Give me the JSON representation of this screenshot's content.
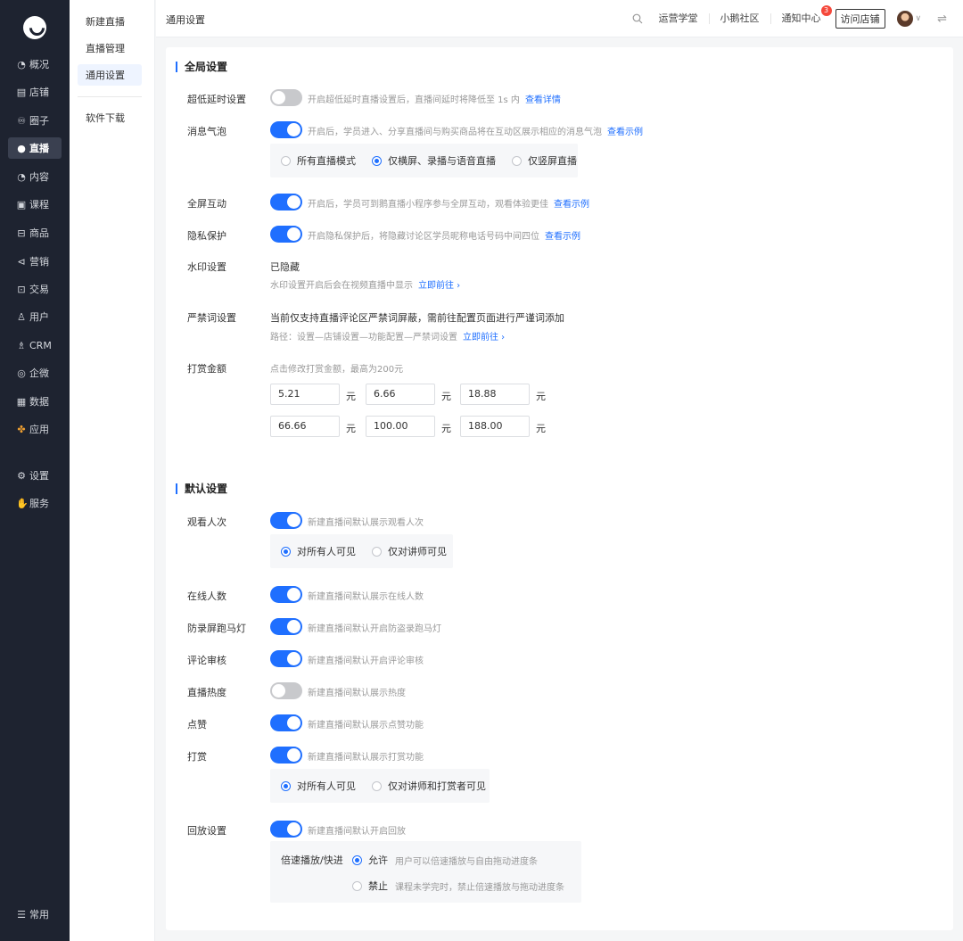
{
  "nav": {
    "items": [
      {
        "icon": "◔",
        "label": "概况"
      },
      {
        "icon": "▤",
        "label": "店铺"
      },
      {
        "icon": "♾",
        "label": "圈子"
      },
      {
        "icon": "●",
        "label": "直播"
      },
      {
        "icon": "◔",
        "label": "内容"
      },
      {
        "icon": "▣",
        "label": "课程"
      },
      {
        "icon": "⊟",
        "label": "商品"
      },
      {
        "icon": "⊲",
        "label": "营销"
      },
      {
        "icon": "⊡",
        "label": "交易"
      },
      {
        "icon": "♙",
        "label": "用户"
      },
      {
        "icon": "♗",
        "label": "CRM"
      },
      {
        "icon": "◎",
        "label": "企微"
      },
      {
        "icon": "▦",
        "label": "数据"
      },
      {
        "icon": "✤",
        "label": "应用"
      },
      {
        "icon": "⚙",
        "label": "设置"
      },
      {
        "icon": "✋",
        "label": "服务"
      },
      {
        "icon": "☰",
        "label": "常用"
      }
    ]
  },
  "submenu": {
    "items": [
      "新建直播",
      "直播管理",
      "通用设置",
      "软件下载"
    ]
  },
  "header": {
    "title": "通用设置",
    "links": [
      "运营学堂",
      "小鹅社区",
      "通知中心"
    ],
    "notify_count": "3",
    "visit_store": "访问店铺"
  },
  "global": {
    "title": "全局设置",
    "low_latency": {
      "label": "超低延时设置",
      "desc": "开启超低延时直播设置后，直播间延时将降低至 1s 内",
      "link": "查看详情"
    },
    "bubble": {
      "label": "消息气泡",
      "desc": "开启后，学员进入、分享直播间与购买商品将在互动区展示相应的消息气泡",
      "link": "查看示例",
      "options": [
        "所有直播模式",
        "仅横屏、录播与语音直播",
        "仅竖屏直播"
      ]
    },
    "fullscreen": {
      "label": "全屏互动",
      "desc": "开启后，学员可到鹅直播小程序参与全屏互动，观看体验更佳",
      "link": "查看示例"
    },
    "privacy": {
      "label": "隐私保护",
      "desc": "开启隐私保护后，将隐藏讨论区学员昵称电话号码中间四位",
      "link": "查看示例"
    },
    "watermark": {
      "label": "水印设置",
      "value": "已隐藏",
      "desc": "水印设置开启后会在视频直播中显示",
      "link": "立即前往 ›"
    },
    "banned": {
      "label": "严禁词设置",
      "value": "当前仅支持直播评论区严禁词屏蔽，需前往配置页面进行严谨词添加",
      "desc": "路径：设置—店铺设置—功能配置—严禁词设置",
      "link": "立即前往 ›"
    },
    "reward": {
      "label": "打赏金额",
      "desc": "点击修改打赏金额，最高为200元",
      "unit": "元",
      "amounts": [
        "5.21",
        "6.66",
        "18.88",
        "66.66",
        "100.00",
        "188.00"
      ]
    }
  },
  "defaults": {
    "title": "默认设置",
    "viewers": {
      "label": "观看人次",
      "desc": "新建直播间默认展示观看人次",
      "options": [
        "对所有人可见",
        "仅对讲师可见"
      ]
    },
    "online": {
      "label": "在线人数",
      "desc": "新建直播间默认展示在线人数"
    },
    "marquee": {
      "label": "防录屏跑马灯",
      "desc": "新建直播间默认开启防盗录跑马灯"
    },
    "review": {
      "label": "评论审核",
      "desc": "新建直播间默认开启评论审核"
    },
    "heat": {
      "label": "直播热度",
      "desc": "新建直播间默认展示热度"
    },
    "like": {
      "label": "点赞",
      "desc": "新建直播间默认展示点赞功能"
    },
    "tip": {
      "label": "打赏",
      "desc": "新建直播间默认展示打赏功能",
      "options": [
        "对所有人可见",
        "仅对讲师和打赏者可见"
      ]
    },
    "replay": {
      "label": "回放设置",
      "desc": "新建直播间默认开启回放",
      "speed_label": "倍速播放/快进",
      "allow": "允许",
      "allow_desc": "用户可以倍速播放与自由拖动进度条",
      "deny": "禁止",
      "deny_desc": "课程未学完时，禁止倍速播放与拖动进度条"
    }
  },
  "colors": {
    "accent": "#1f6fff",
    "nav_bg": "#1e2330",
    "badge": "#f5483b"
  }
}
